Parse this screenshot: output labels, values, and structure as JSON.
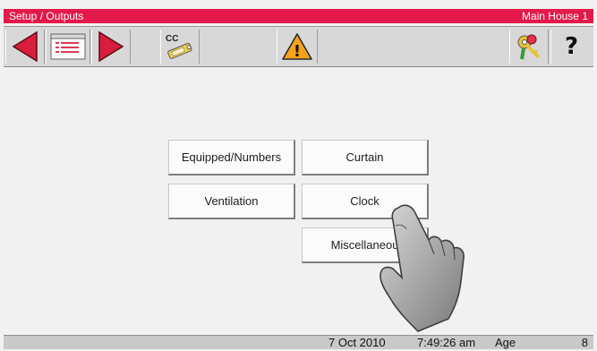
{
  "title": {
    "breadcrumb": "Setup / Outputs",
    "location": "Main House 1"
  },
  "toolbar": {
    "items": [
      {
        "name": "back-arrow-icon"
      },
      {
        "name": "list-icon"
      },
      {
        "name": "forward-arrow-icon"
      },
      {
        "name": "cc-key-icon",
        "label": "CC"
      },
      {
        "name": "warning-icon",
        "label": "!"
      },
      {
        "name": "keys-icon"
      },
      {
        "name": "help-icon",
        "label": "?"
      }
    ]
  },
  "menu": {
    "equipped_numbers": "Equipped/Numbers",
    "curtain": "Curtain",
    "ventilation": "Ventilation",
    "clock": "Clock",
    "miscellaneous": "Miscellaneou"
  },
  "status": {
    "date": "7 Oct 2010",
    "time": "7:49:26 am",
    "age_label": "Age",
    "age_value": "8"
  },
  "colors": {
    "title_bar": "#e2194a",
    "arrow_red": "#d81e3c",
    "warning_orange": "#f7a21b"
  }
}
